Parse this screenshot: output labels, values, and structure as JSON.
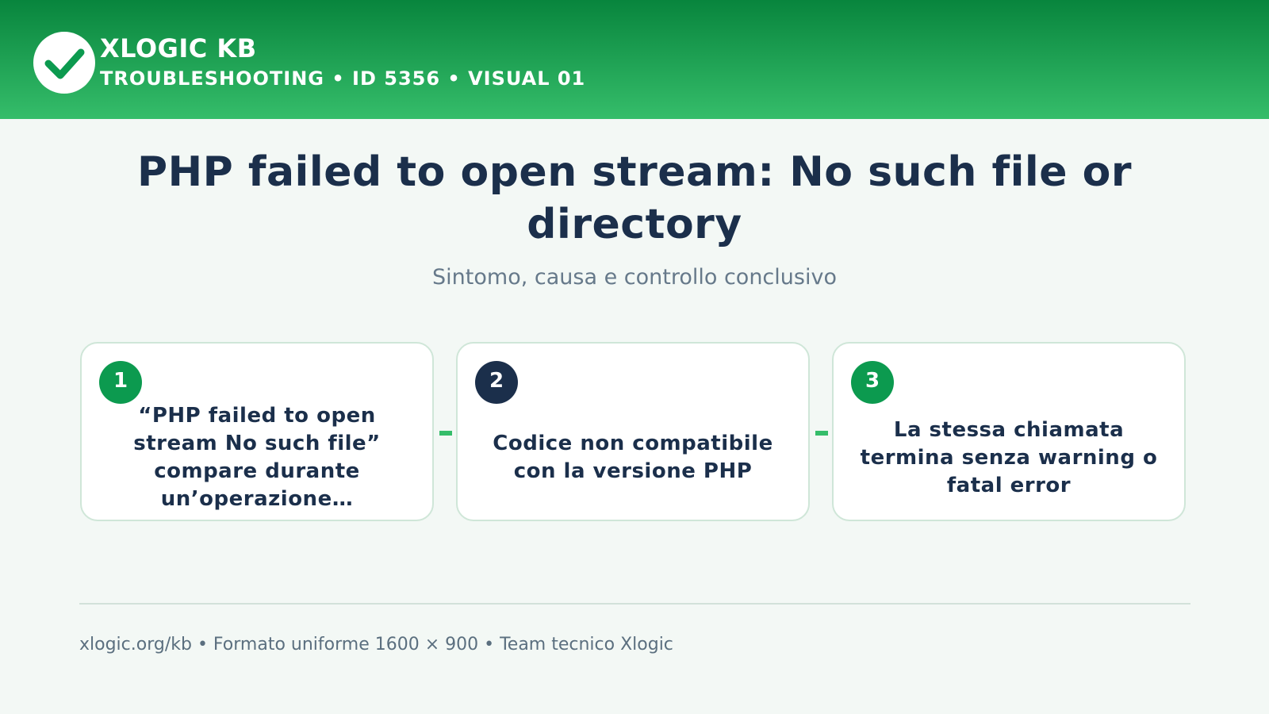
{
  "header": {
    "brand": "XLOGIC KB",
    "subline": "TROUBLESHOOTING • ID 5356 • VISUAL 01",
    "logo_icon": "checkmark-icon"
  },
  "main": {
    "title": "PHP failed to open stream: No such file or directory",
    "subtitle": "Sintomo, causa e controllo conclusivo"
  },
  "steps": [
    {
      "number": "1",
      "text": "“PHP failed to open stream No such file” compare durante un’operazione…",
      "badge_color": "#0c9a4f"
    },
    {
      "number": "2",
      "text": "Codice non compatibile con la versione PHP",
      "badge_color": "#1b2f4b"
    },
    {
      "number": "3",
      "text": "La stessa chiamata termina senza warning o fatal error",
      "badge_color": "#0c9a4f"
    }
  ],
  "footer": {
    "text": "xlogic.org/kb • Formato uniforme 1600 × 900 • Team tecnico Xlogic"
  },
  "colors": {
    "brand_green": "#0c9a4f",
    "header_gradient_top": "#08853d",
    "header_gradient_bottom": "#35bd6a",
    "navy": "#1b2f4b",
    "background": "#f3f8f5"
  }
}
